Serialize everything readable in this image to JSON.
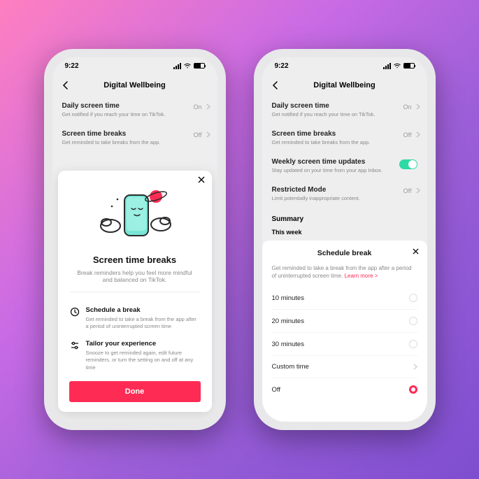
{
  "status": {
    "time": "9:22"
  },
  "nav": {
    "title": "Digital Wellbeing"
  },
  "settings": {
    "daily": {
      "title": "Daily screen time",
      "sub": "Get notified if you reach your time on TikTok.",
      "value": "On"
    },
    "breaks": {
      "title": "Screen time breaks",
      "sub": "Get reminded to take breaks from the app.",
      "value": "Off"
    },
    "weekly": {
      "title": "Weekly screen time updates",
      "sub": "Stay updated on your time from your app Inbox."
    },
    "restricted": {
      "title": "Restricted Mode",
      "sub": "Limit potentially inappropriate content.",
      "value": "Off"
    }
  },
  "summary": {
    "header": "Summary",
    "tab": "This week"
  },
  "modal": {
    "title": "Screen time breaks",
    "sub": "Break reminders help you feel more mindful and balanced on TikTok.",
    "feat1_t": "Schedule a break",
    "feat1_d": "Get reminded to take a break from the app after a period of uninterrupted screen time",
    "feat2_t": "Tailor your experience",
    "feat2_d": "Snooze to get reminded again, edit future reminders, or turn the setting on and off at any time",
    "done": "Done"
  },
  "sheet": {
    "title": "Schedule break",
    "desc": "Get reminded to take a break from the app after a period of uninterrupted screen time. ",
    "learn": "Learn more >",
    "opts": {
      "o1": "10 minutes",
      "o2": "20 minutes",
      "o3": "30 minutes",
      "o4": "Custom time",
      "o5": "Off"
    }
  }
}
